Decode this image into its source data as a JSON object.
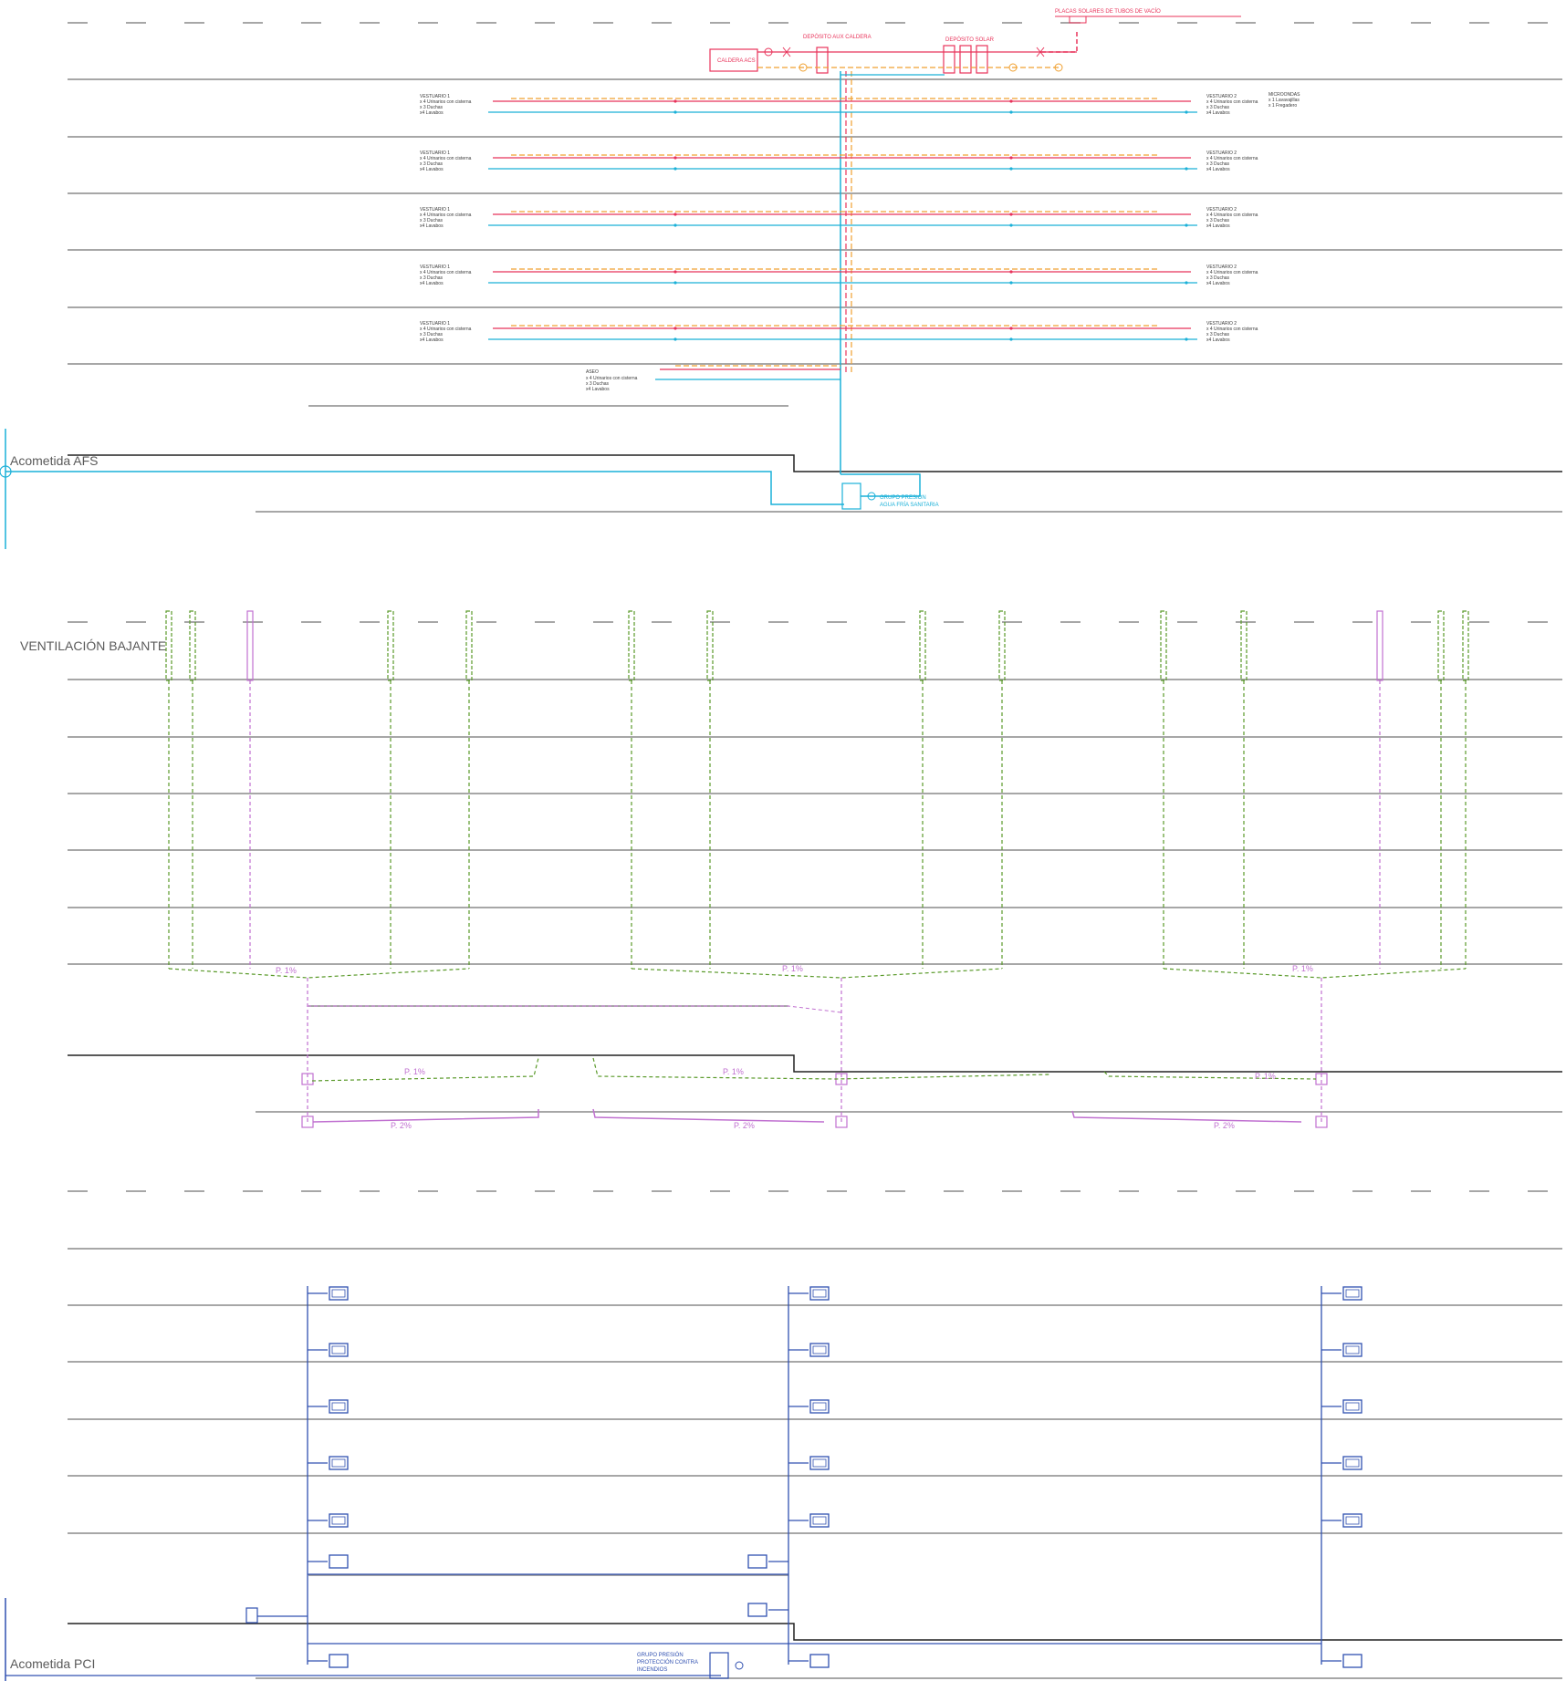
{
  "labels": {
    "acometida_afs": "Acometida AFS",
    "ventilacion_bajante": "VENTILACIÓN BAJANTE",
    "acometida_pci": "Acometida PCI",
    "placas_solares": "PLACAS SOLARES DE TUBOS DE VACÍO",
    "deposito_aux": "DEPÓSITO AUX CALDERA",
    "deposito_solar": "DEPÓSITO SOLAR",
    "caldera": "CALDERA ACS",
    "grupo_afs_1": "GRUPO PRESIÓN",
    "grupo_afs_2": "AGUA FRÍA SANITARIA",
    "grupo_pci_1": "GRUPO PRESIÓN",
    "grupo_pci_2": "PROTECCIÓN CONTRA",
    "grupo_pci_3": "INCENDIOS"
  },
  "rooms": {
    "v1": [
      "VESTUARIO 1",
      "x 4 Urinarios con cisterna",
      "x 3 Duchas",
      "x4 Lavabos"
    ],
    "v2": [
      "VESTUARIO 2",
      "x 4 Urinarios con cisterna",
      "x 3 Duchas",
      "x4 Lavabos"
    ],
    "micro": [
      "MICROONDAS",
      "x 1 Lavavajillas",
      "x 1 Fregadero"
    ],
    "aseo": [
      "ASEO",
      "x 4 Urinarios con cisterna",
      "x 3 Duchas",
      "x4 Lavabos"
    ]
  },
  "slopes": {
    "p1": "P. 1%",
    "p2": "P. 2%"
  },
  "colors": {
    "cold_water": "#1ab0d8",
    "hot_water": "#e8335a",
    "return_water": "#f0a030",
    "vent": "#5a9a2a",
    "drain": "#c070d0",
    "fire": "#3050b0",
    "floor": "#8a8a8a"
  }
}
